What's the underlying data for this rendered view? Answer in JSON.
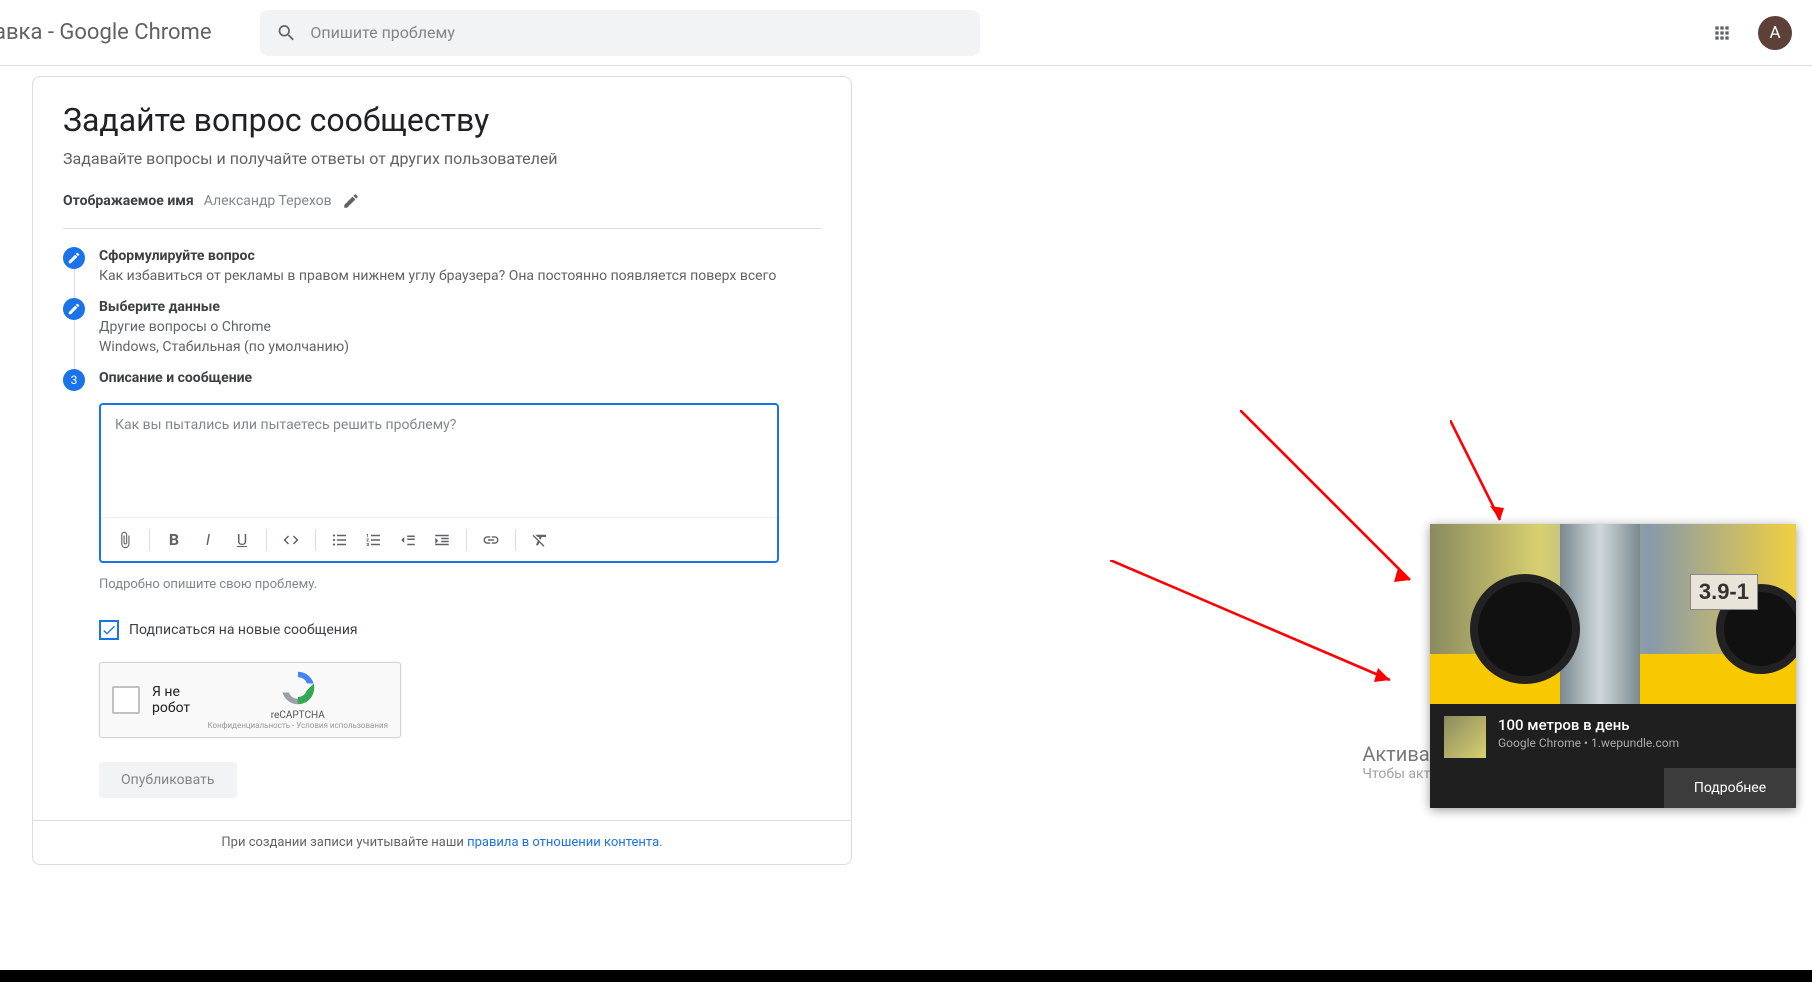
{
  "header": {
    "title": "авка - Google Chrome",
    "search_placeholder": "Опишите проблему",
    "avatar_letter": "A"
  },
  "page": {
    "heading": "Задайте вопрос сообществу",
    "subtitle": "Задавайте вопросы и получайте ответы от других пользователей",
    "display_name_label": "Отображаемое имя",
    "display_name_value": "Александр Терехов"
  },
  "steps": {
    "s1": {
      "title": "Сформулируйте вопрос",
      "sub": "Как избавиться от рекламы в правом нижнем углу браузера? Она постоянно появляется поверх всего"
    },
    "s2": {
      "title": "Выберите данные",
      "sub1": "Другие вопросы о Chrome",
      "sub2": "Windows, Стабильная (по умолчанию)"
    },
    "s3": {
      "number": "3",
      "title": "Описание и сообщение"
    }
  },
  "editor": {
    "placeholder": "Как вы пытались или пытаетесь решить проблему?",
    "helper": "Подробно опишите свою проблему."
  },
  "subscribe": {
    "label": "Подписаться на новые сообщения"
  },
  "captcha": {
    "label": "Я не робот",
    "brand": "reCAPTCHA",
    "links": "Конфиденциальность - Условия использования"
  },
  "publish": "Опубликовать",
  "footer": {
    "prefix": "При создании записи учитывайте наши ",
    "link": "правила в отношении контента",
    "suffix": "."
  },
  "watermark": {
    "title": "Активация Windows",
    "sub": "Чтобы активировать Windows, перейдите в раздел \"Параметры\"."
  },
  "notification": {
    "sign_text": "3.9-1",
    "title": "100 метров в день",
    "source": "Google Chrome • 1.wepundle.com",
    "action": "Подробнее"
  }
}
